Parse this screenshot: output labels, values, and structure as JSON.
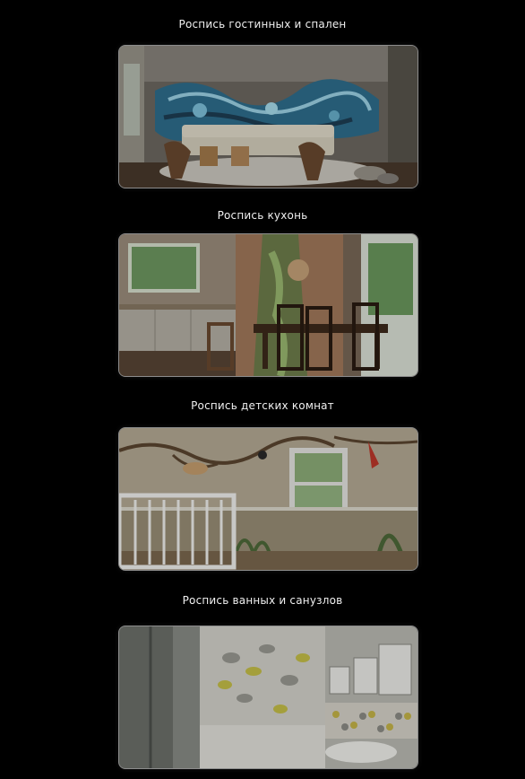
{
  "sections": [
    {
      "title": "Роспись гостинных и спален"
    },
    {
      "title": "Роспись кухонь"
    },
    {
      "title": "Роспись детских комнат"
    },
    {
      "title": "Роспись ванных и санузлов"
    }
  ]
}
